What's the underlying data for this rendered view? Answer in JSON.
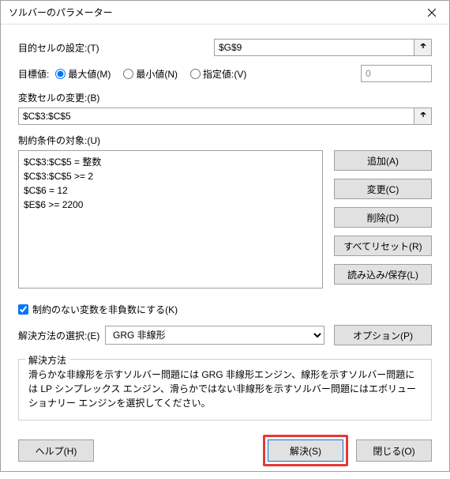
{
  "window": {
    "title": "ソルバーのパラメーター"
  },
  "labels": {
    "objective": "目的セルの設定:(T)",
    "to": "目標値:",
    "max": "最大値(M)",
    "min": "最小値(N)",
    "value_of": "指定値:(V)",
    "variables": "変数セルの変更:(B)",
    "constraints": "制約条件の対象:(U)",
    "nonneg": "制約のない変数を非負数にする(K)",
    "method": "解決方法の選択:(E)",
    "method_group": "解決方法"
  },
  "fields": {
    "objective": "$G$9",
    "value_of": "0",
    "variables": "$C$3:$C$5",
    "constraints_text": "$C$3:$C$5 = 整数\n$C$3:$C$5 >= 2\n$C$6 = 12\n$E$6 >= 2200",
    "method_selected": "GRG 非線形",
    "nonneg_checked": true,
    "radio_selected": "max"
  },
  "buttons": {
    "add": "追加(A)",
    "change": "変更(C)",
    "delete": "削除(D)",
    "reset": "すべてリセット(R)",
    "loadsave": "読み込み/保存(L)",
    "options": "オプション(P)",
    "help": "ヘルプ(H)",
    "solve": "解決(S)",
    "close": "閉じる(O)"
  },
  "description": "滑らかな非線形を示すソルバー問題には GRG 非線形エンジン、線形を示すソルバー問題には LP シンプレックス エンジン、滑らかではない非線形を示すソルバー問題にはエボリューショナリー エンジンを選択してください。"
}
